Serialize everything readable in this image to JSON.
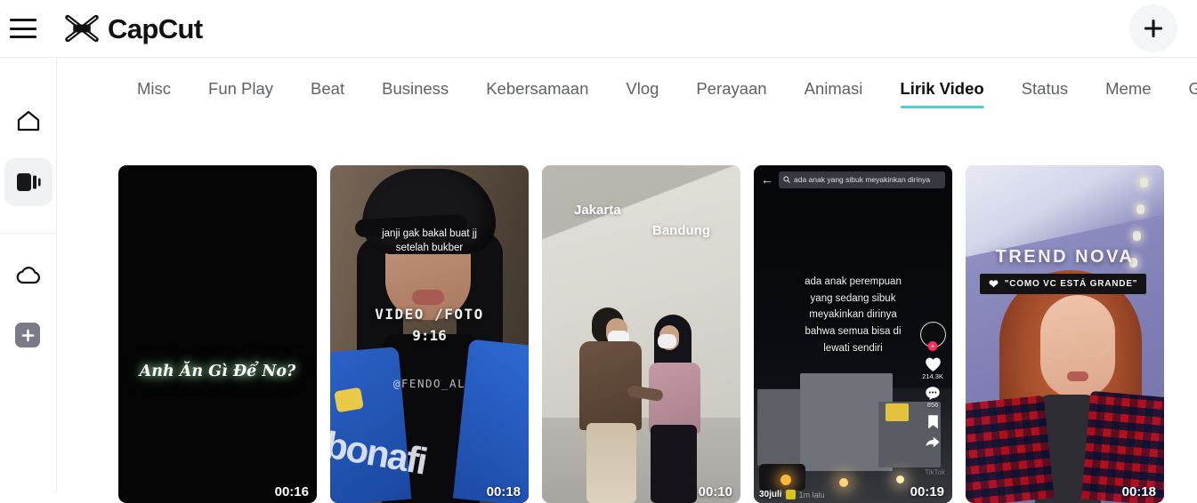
{
  "header": {
    "menu_icon": "hamburger-menu-icon",
    "logo_icon": "capcut-logo-icon",
    "brand": "CapCut",
    "add_icon": "plus-icon"
  },
  "sidebar": {
    "items": [
      {
        "icon": "home-icon",
        "name": "home",
        "active": false
      },
      {
        "icon": "templates-icon",
        "name": "templates",
        "active": true
      },
      {
        "icon": "cloud-icon",
        "name": "cloud",
        "active": false
      }
    ],
    "add_button": {
      "icon": "plus-icon",
      "label": "+"
    }
  },
  "tabs": {
    "items": [
      {
        "label": "Misc",
        "active": false
      },
      {
        "label": "Fun Play",
        "active": false
      },
      {
        "label": "Beat",
        "active": false
      },
      {
        "label": "Business",
        "active": false
      },
      {
        "label": "Kebersamaan",
        "active": false
      },
      {
        "label": "Vlog",
        "active": false
      },
      {
        "label": "Perayaan",
        "active": false
      },
      {
        "label": "Animasi",
        "active": false
      },
      {
        "label": "Lirik Video",
        "active": true
      },
      {
        "label": "Status",
        "active": false
      },
      {
        "label": "Meme",
        "active": false
      },
      {
        "label": "Game",
        "active": false
      }
    ],
    "active_underline_color": "#4ecfd4"
  },
  "cards": {
    "card1": {
      "lyric": "Anh Ăn Gì Để No?",
      "duration": "00:16"
    },
    "card2": {
      "caption_line1": "janji gak bakal buat jj",
      "caption_line2": "setelah bukber",
      "videofoto": "VIDEO /FOTO",
      "ratio": "9:16",
      "handle": "@FENDO_AL",
      "duration": "00:18"
    },
    "card3": {
      "label_a": "Jakarta",
      "label_b": "Bandung",
      "duration": "00:10"
    },
    "card4": {
      "search_query": "ada anak yang sibuk meyakinkan dirinya",
      "back_icon": "arrow-left-icon",
      "search_icon": "search-icon",
      "lyric_line1": "ada anak perempuan",
      "lyric_line2": "yang sedang sibuk",
      "lyric_line3": "meyakinkan dirinya",
      "lyric_line4": "bahwa semua bisa di",
      "lyric_line5": "lewati sendiri",
      "avatar_plus": "+",
      "likes": "214.3K",
      "comments": "856",
      "username": "30juli",
      "time_ago": "1m lalu",
      "watermark": "TikTok",
      "duration": "00:19"
    },
    "card5": {
      "title": "TREND NOVA",
      "caption": "\"COMO VC ESTÁ GRANDE\"",
      "heart_icon": "heart-icon",
      "duration": "00:18"
    }
  }
}
